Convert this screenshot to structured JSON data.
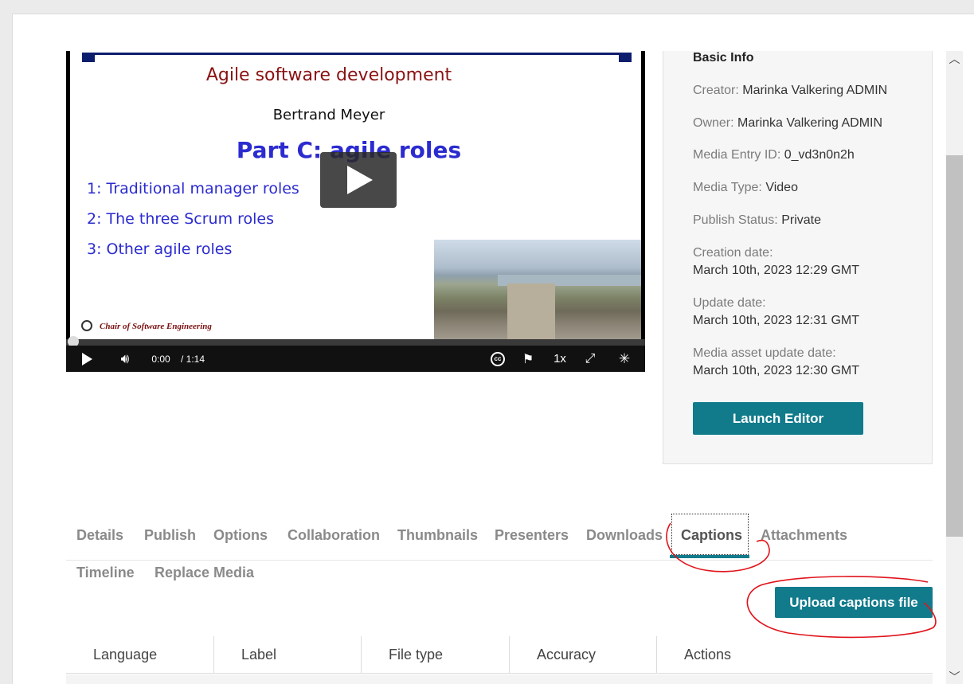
{
  "slide": {
    "title": "Agile software development",
    "author": "Bertrand Meyer",
    "part": "Part C: agile roles",
    "items": [
      "1: Traditional manager roles",
      "2: The three Scrum roles",
      "3: Other agile roles"
    ],
    "footer": "Chair of Software Engineering"
  },
  "player": {
    "current_time": "0:00",
    "duration": "/ 1:14",
    "speed": "1x",
    "progress": 0.0
  },
  "info": {
    "heading": "Basic Info",
    "creator_key": "Creator:",
    "creator_val": "Marinka Valkering ADMIN",
    "owner_key": "Owner:",
    "owner_val": "Marinka Valkering ADMIN",
    "entry_key": "Media Entry ID:",
    "entry_val": "0_vd3n0n2h",
    "type_key": "Media Type:",
    "type_val": "Video",
    "status_key": "Publish Status:",
    "status_val": "Private",
    "created_key": "Creation date:",
    "created_val": "March 10th, 2023 12:29 GMT",
    "updated_key": "Update date:",
    "updated_val": "March 10th, 2023 12:31 GMT",
    "asset_key": "Media asset update date:",
    "asset_val": "March 10th, 2023 12:30 GMT",
    "launch_editor": "Launch Editor"
  },
  "tabs": [
    "Details",
    "Publish",
    "Options",
    "Collaboration",
    "Thumbnails",
    "Presenters",
    "Downloads",
    "Captions",
    "Attachments",
    "Timeline",
    "Replace Media"
  ],
  "active_tab": "Captions",
  "upload_button": "Upload captions file",
  "table": {
    "headers": [
      "Language",
      "Label",
      "File type",
      "Accuracy",
      "Actions"
    ]
  },
  "colors": {
    "accent": "#117b8c",
    "annotation": "#e0141c"
  }
}
